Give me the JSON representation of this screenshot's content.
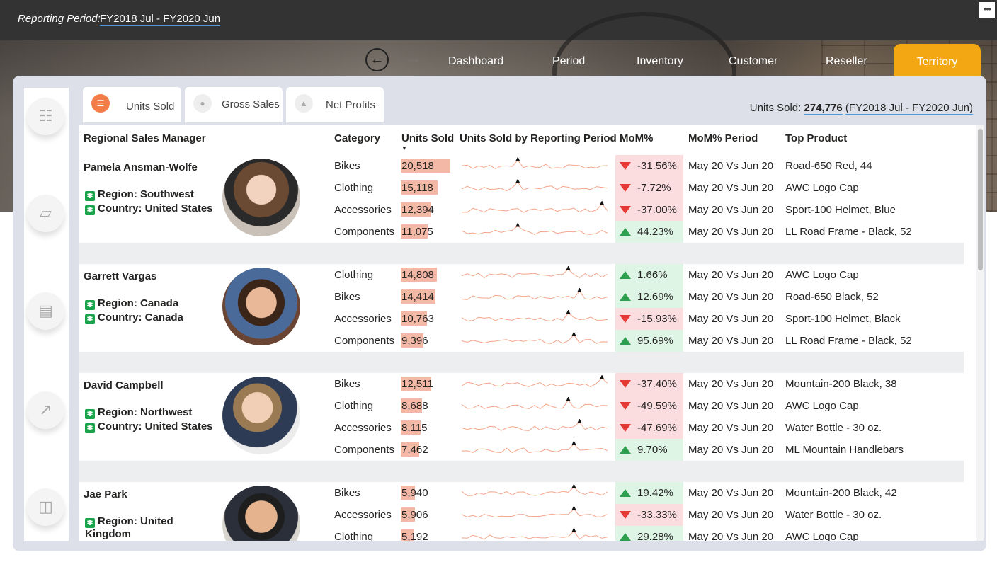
{
  "report": {
    "period_label": "Reporting Period:",
    "period_value": "FY2018  Jul - FY2020  Jun",
    "more_label": "•••"
  },
  "nav": {
    "back_icon": "back-arrow-icon",
    "forward_icon": "forward-arrow-icon",
    "items": [
      "Dashboard",
      "Period",
      "Inventory",
      "Customer",
      "Reseller",
      "Territory"
    ],
    "active": "Territory"
  },
  "sidebar": {
    "icons": [
      "abacus-icon",
      "hand-chart-icon",
      "money-icon",
      "growth-chart-icon",
      "database-icon"
    ]
  },
  "tabs": [
    {
      "label": "Units Sold",
      "icon": "units-icon",
      "active": true
    },
    {
      "label": "Gross Sales",
      "icon": "coins-icon",
      "active": false
    },
    {
      "label": "Net Profits",
      "icon": "profit-icon",
      "active": false
    }
  ],
  "summary": {
    "label": "Units Sold:",
    "value": "274,776",
    "period": "(FY2018  Jul - FY2020  Jun)"
  },
  "table": {
    "headers": [
      "Regional Sales Manager",
      "Category",
      "Units Sold",
      "Units Sold by Reporting Period",
      "MoM%",
      "MoM% Period",
      "Top Product"
    ],
    "colors": {
      "bar": "#f4b9a6",
      "neg_bg": "#fbdde0",
      "pos_bg": "#def5e6",
      "down": "#e53935",
      "up": "#2e9e4f"
    },
    "managers": [
      {
        "name": "Pamela Ansman-Wolfe",
        "region": "Region: Southwest",
        "country": "Country: United States",
        "rows": [
          {
            "category": "Bikes",
            "units": "20,518",
            "units_value": 20518,
            "mom": "-31.56%",
            "dir": "down",
            "period": "May 20 Vs Jun 20",
            "product": "Road-650 Red, 44"
          },
          {
            "category": "Clothing",
            "units": "15,118",
            "units_value": 15118,
            "mom": "-7.72%",
            "dir": "down",
            "period": "May 20 Vs Jun 20",
            "product": "AWC Logo Cap"
          },
          {
            "category": "Accessories",
            "units": "12,394",
            "units_value": 12394,
            "mom": "-37.00%",
            "dir": "down",
            "period": "May 20 Vs Jun 20",
            "product": "Sport-100 Helmet, Blue"
          },
          {
            "category": "Components",
            "units": "11,075",
            "units_value": 11075,
            "mom": "44.23%",
            "dir": "up",
            "period": "May 20 Vs Jun 20",
            "product": "LL Road Frame - Black, 52"
          }
        ]
      },
      {
        "name": "Garrett Vargas",
        "region": "Region: Canada",
        "country": "Country: Canada",
        "rows": [
          {
            "category": "Clothing",
            "units": "14,808",
            "units_value": 14808,
            "mom": "1.66%",
            "dir": "up",
            "period": "May 20 Vs Jun 20",
            "product": "AWC Logo Cap"
          },
          {
            "category": "Bikes",
            "units": "14,414",
            "units_value": 14414,
            "mom": "12.69%",
            "dir": "up",
            "period": "May 20 Vs Jun 20",
            "product": "Road-650 Black, 52"
          },
          {
            "category": "Accessories",
            "units": "10,763",
            "units_value": 10763,
            "mom": "-15.93%",
            "dir": "down",
            "period": "May 20 Vs Jun 20",
            "product": "Sport-100 Helmet, Black"
          },
          {
            "category": "Components",
            "units": "9,396",
            "units_value": 9396,
            "mom": "95.69%",
            "dir": "up",
            "period": "May 20 Vs Jun 20",
            "product": "LL Road Frame - Black, 52"
          }
        ]
      },
      {
        "name": "David Campbell",
        "region": "Region: Northwest",
        "country": "Country: United States",
        "rows": [
          {
            "category": "Bikes",
            "units": "12,511",
            "units_value": 12511,
            "mom": "-37.40%",
            "dir": "down",
            "period": "May 20 Vs Jun 20",
            "product": "Mountain-200 Black, 38"
          },
          {
            "category": "Clothing",
            "units": "8,688",
            "units_value": 8688,
            "mom": "-49.59%",
            "dir": "down",
            "period": "May 20 Vs Jun 20",
            "product": "AWC Logo Cap"
          },
          {
            "category": "Accessories",
            "units": "8,115",
            "units_value": 8115,
            "mom": "-47.69%",
            "dir": "down",
            "period": "May 20 Vs Jun 20",
            "product": "Water Bottle - 30 oz."
          },
          {
            "category": "Components",
            "units": "7,462",
            "units_value": 7462,
            "mom": "9.70%",
            "dir": "up",
            "period": "May 20 Vs Jun 20",
            "product": "ML Mountain Handlebars"
          }
        ]
      },
      {
        "name": "Jae Park",
        "region": "Region: United Kingdom",
        "country": "",
        "rows": [
          {
            "category": "Bikes",
            "units": "5,940",
            "units_value": 5940,
            "mom": "19.42%",
            "dir": "up",
            "period": "May 20 Vs Jun 20",
            "product": "Mountain-200 Black, 42"
          },
          {
            "category": "Accessories",
            "units": "5,906",
            "units_value": 5906,
            "mom": "-33.33%",
            "dir": "down",
            "period": "May 20 Vs Jun 20",
            "product": "Water Bottle - 30 oz."
          },
          {
            "category": "Clothing",
            "units": "5,192",
            "units_value": 5192,
            "mom": "29.28%",
            "dir": "up",
            "period": "May 20 Vs Jun 20",
            "product": "AWC Logo Cap"
          }
        ]
      }
    ]
  }
}
